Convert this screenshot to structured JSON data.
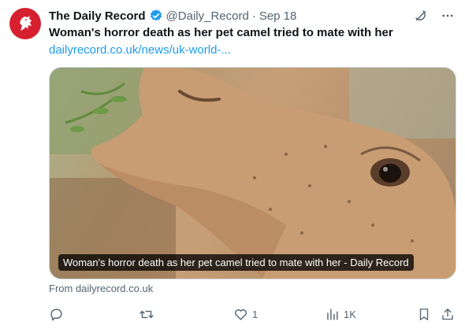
{
  "tweet": {
    "author_name": "The Daily Record",
    "handle": "@Daily_Record",
    "separator": "·",
    "date": "Sep 18",
    "title": "Woman's horror death as her pet camel tried to mate with her",
    "link_text": "dailyrecord.co.uk/news/uk-world-...",
    "card_caption": "Woman's horror death as her pet camel tried to mate with her - Daily Record",
    "from_text": "From dailyrecord.co.uk"
  },
  "metrics": {
    "replies": "",
    "retweets": "",
    "likes": "1",
    "views": "1K"
  },
  "colors": {
    "accent": "#1d9bf0",
    "avatar_bg": "#d6202f",
    "muted": "#536471"
  },
  "icons": [
    "verified-icon",
    "grok-icon",
    "more-icon",
    "reply-icon",
    "retweet-icon",
    "like-icon",
    "views-icon",
    "bookmark-icon",
    "share-icon"
  ]
}
